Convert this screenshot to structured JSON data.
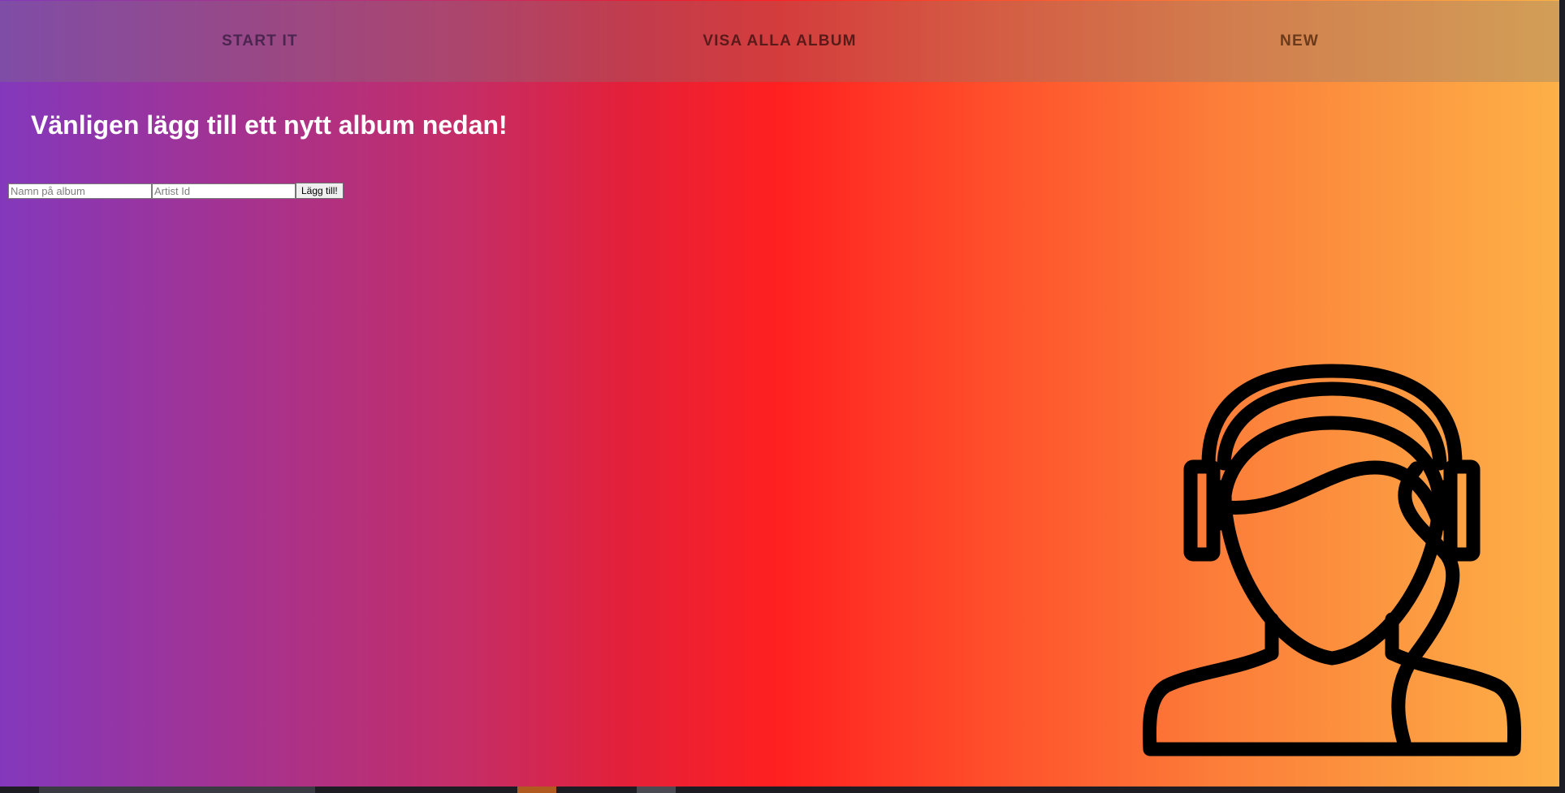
{
  "nav": {
    "items": [
      {
        "label": "START IT"
      },
      {
        "label": "VISA ALLA ALBUM"
      },
      {
        "label": "NEW"
      }
    ]
  },
  "main": {
    "heading": "Vänligen lägg till ett nytt album nedan!"
  },
  "form": {
    "album_name": {
      "value": "",
      "placeholder": "Namn på album"
    },
    "artist_id": {
      "value": "",
      "placeholder": "Artist Id"
    },
    "submit_label": "Lägg till!"
  },
  "illustration": {
    "icon": "headset-person-icon"
  },
  "colors": {
    "gradient": [
      "#8338bc",
      "#ff2020",
      "#fdb047"
    ],
    "heading_text": "#ffffff",
    "icon_stroke": "#000000"
  }
}
